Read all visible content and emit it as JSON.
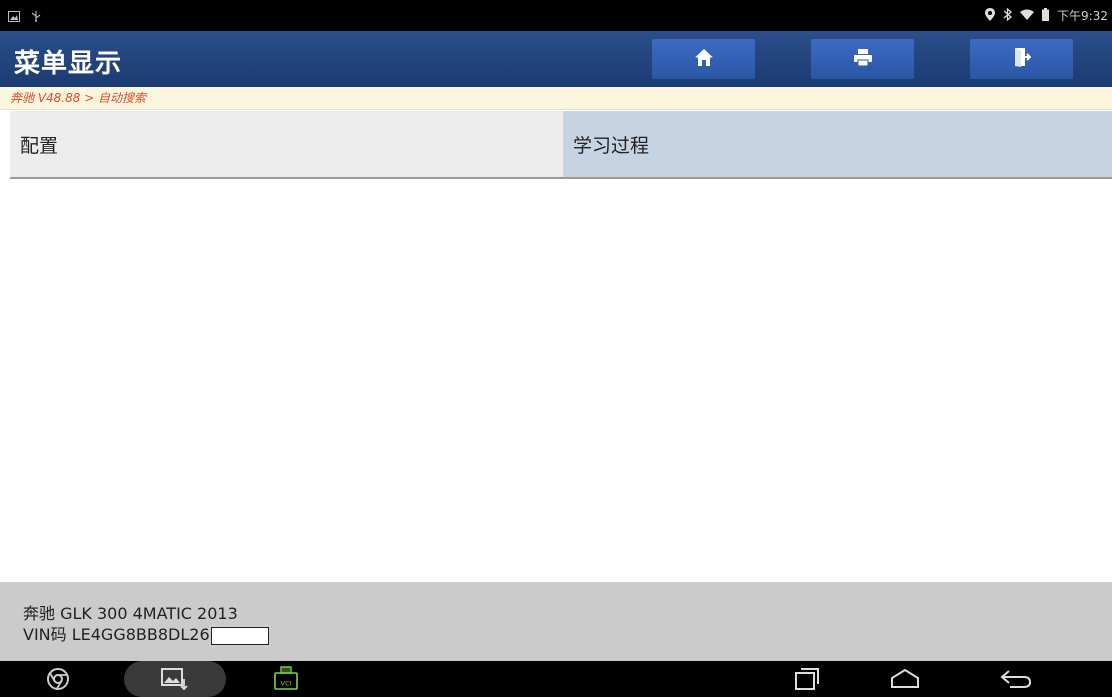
{
  "status_bar": {
    "time": "下午9:32",
    "left_icons": [
      "image-notification-icon",
      "usb-icon"
    ],
    "right_icons": [
      "location-icon",
      "bluetooth-icon",
      "wifi-icon",
      "battery-icon"
    ]
  },
  "header": {
    "title": "菜单显示",
    "buttons": [
      {
        "name": "home-button",
        "icon": "home-icon"
      },
      {
        "name": "print-button",
        "icon": "printer-icon"
      },
      {
        "name": "exit-button",
        "icon": "exit-icon"
      }
    ]
  },
  "breadcrumb": "奔驰 V48.88 > 自动搜索",
  "menu": {
    "items": [
      {
        "label": "配置"
      },
      {
        "label": "学习过程"
      }
    ]
  },
  "vehicle": {
    "model": "奔驰 GLK 300 4MATIC 2013",
    "vin": "VIN码 LE4GG8BB8DL26"
  },
  "nav_bar": {
    "icons": [
      "chrome-icon",
      "gallery-icon",
      "vci-icon",
      "recent-apps-icon",
      "home-icon",
      "back-icon"
    ],
    "vci_label": "VCI"
  },
  "colors": {
    "header_bg": "#1f4178",
    "button_bg": "#3262b8",
    "breadcrumb_text": "#d94d2b",
    "menu_left_bg": "#ececec",
    "menu_right_bg": "#c5d3e2",
    "footer_bg": "#cbcbcb"
  }
}
